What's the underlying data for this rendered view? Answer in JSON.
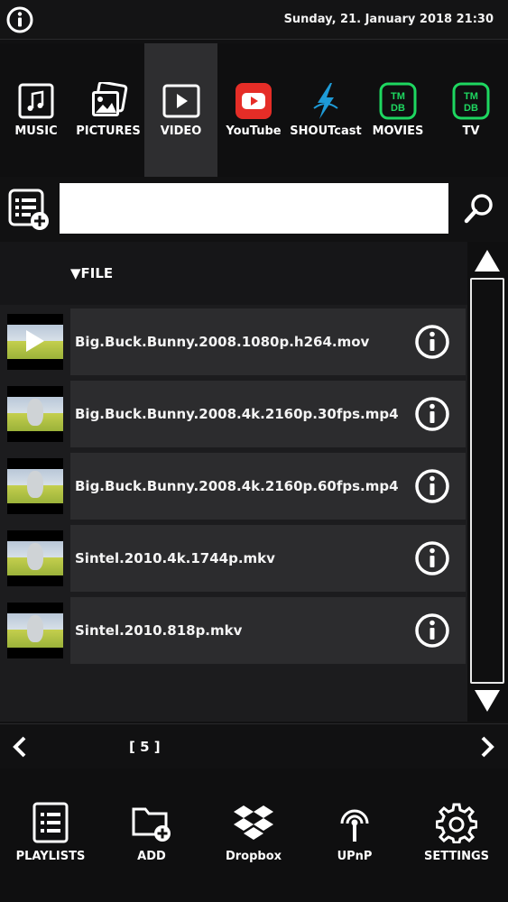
{
  "topbar": {
    "datetime": "Sunday, 21. January 2018 21:30"
  },
  "nav": {
    "items": [
      {
        "label": "MUSIC",
        "icon": "music-icon"
      },
      {
        "label": "PICTURES",
        "icon": "pictures-icon"
      },
      {
        "label": "VIDEO",
        "icon": "video-icon",
        "active": true
      },
      {
        "label": "YouTube",
        "icon": "youtube-icon"
      },
      {
        "label": "SHOUTcast",
        "icon": "shoutcast-icon"
      },
      {
        "label": "MOVIES",
        "icon": "tmdb-icon",
        "badge": "TM DB"
      },
      {
        "label": "TV",
        "icon": "tmdb-icon",
        "badge": "TM DB"
      }
    ]
  },
  "search": {
    "value": "",
    "placeholder": ""
  },
  "list": {
    "column_header": "FILE",
    "files": [
      {
        "name": "Big.Buck.Bunny.2008.1080p.h264.mov",
        "playing": true
      },
      {
        "name": "Big.Buck.Bunny.2008.4k.2160p.30fps.mp4"
      },
      {
        "name": "Big.Buck.Bunny.2008.4k.2160p.60fps.mp4"
      },
      {
        "name": "Sintel.2010.4k.1744p.mkv"
      },
      {
        "name": "Sintel.2010.818p.mkv"
      }
    ]
  },
  "pager": {
    "label": "[ 5 ]"
  },
  "bottom": {
    "items": [
      {
        "label": "PLAYLISTS",
        "icon": "playlist-icon"
      },
      {
        "label": "ADD",
        "icon": "add-folder-icon"
      },
      {
        "label": "Dropbox",
        "icon": "dropbox-icon"
      },
      {
        "label": "UPnP",
        "icon": "upnp-icon"
      },
      {
        "label": "SETTINGS",
        "icon": "gear-icon"
      }
    ]
  },
  "colors": {
    "youtube_red": "#e52d27",
    "tmdb_green": "#1ed760",
    "shoutcast_blue": "#1e9bd7",
    "active_tab": "#2e2e30"
  }
}
